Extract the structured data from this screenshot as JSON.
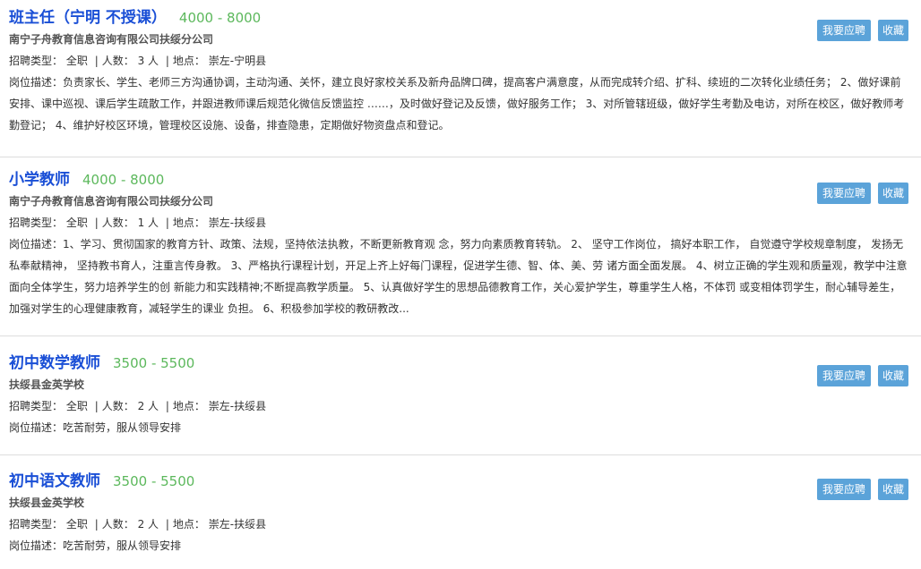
{
  "labels": {
    "type_prefix": "招聘类型：",
    "count_prefix": "人数：",
    "location_prefix": "地点：",
    "desc_prefix": "岗位描述：",
    "apply_button": "我要应聘",
    "fav_button": "收藏",
    "separator": "|"
  },
  "jobs": [
    {
      "title": "班主任（宁明 不授课）",
      "salary": "4000 - 8000",
      "company": "南宁子舟教育信息咨询有限公司扶绥分公司",
      "type": "全职",
      "count": "3 人",
      "location": "崇左-宁明县",
      "description": "负责家长、学生、老师三方沟通协调，主动沟通、关怀，建立良好家校关系及新舟品牌口碑，提高客户满意度，从而完成转介绍、扩科、续班的二次转化业绩任务； 2、做好课前安排、课中巡视、课后学生疏散工作，并跟进教师课后规范化微信反馈监控 ……，及时做好登记及反馈，做好服务工作； 3、对所管辖班级，做好学生考勤及电访，对所在校区，做好教师考勤登记； 4、维护好校区环境，管理校区设施、设备，排查隐患，定期做好物资盘点和登记。"
    },
    {
      "title": "小学教师",
      "salary": "4000 - 8000",
      "company": "南宁子舟教育信息咨询有限公司扶绥分公司",
      "type": "全职",
      "count": "1 人",
      "location": "崇左-扶绥县",
      "description": "1、学习、贯彻国家的教育方针、政策、法规，坚持依法执教，不断更新教育观 念，努力向素质教育转轨。 2、 坚守工作岗位， 搞好本职工作， 自觉遵守学校规章制度， 发扬无私奉献精神， 坚持教书育人，注重言传身教。 3、严格执行课程计划，开足上齐上好每门课程，促进学生德、智、体、美、劳 诸方面全面发展。 4、树立正确的学生观和质量观，教学中注意面向全体学生，努力培养学生的创 新能力和实践精神;不断提高教学质量。 5、认真做好学生的思想品德教育工作，关心爱护学生，尊重学生人格，不体罚 或变相体罚学生，耐心辅导差生，加强对学生的心理健康教育，减轻学生的课业 负担。 6、积极参加学校的教研教改..."
    },
    {
      "title": "初中数学教师",
      "salary": "3500 - 5500",
      "company": "扶绥县金英学校",
      "type": "全职",
      "count": "2 人",
      "location": "崇左-扶绥县",
      "description": "吃苦耐劳，服从领导安排"
    },
    {
      "title": "初中语文教师",
      "salary": "3500 - 5500",
      "company": "扶绥县金英学校",
      "type": "全职",
      "count": "2 人",
      "location": "崇左-扶绥县",
      "description": "吃苦耐劳，服从领导安排"
    }
  ]
}
